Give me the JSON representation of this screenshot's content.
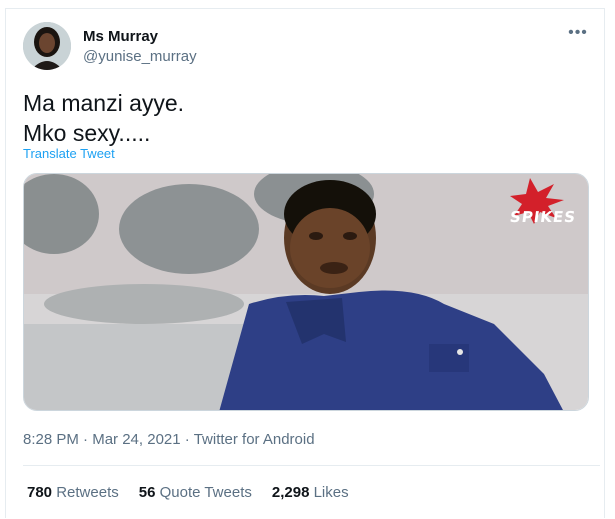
{
  "author": {
    "name": "Ms Murray",
    "handle": "@yunise_murray"
  },
  "tweet": {
    "lines": [
      "Ma manzi ayye.",
      "Mko sexy....."
    ],
    "translate_label": "Translate Tweet"
  },
  "media": {
    "watermark": "SPIKES"
  },
  "meta": {
    "time": "8:28 PM",
    "date": "Mar 24, 2021",
    "source": "Twitter for Android",
    "separator": "·"
  },
  "stats": {
    "retweets": {
      "count": "780",
      "label": "Retweets"
    },
    "quotes": {
      "count": "56",
      "label": "Quote Tweets"
    },
    "likes": {
      "count": "2,298",
      "label": "Likes"
    }
  },
  "menu": {
    "icon": "more-options-icon",
    "glyph": "•••"
  },
  "colors": {
    "link": "#1da1f2",
    "secondary_text": "#5b7083",
    "divider": "#e6ecf0"
  }
}
